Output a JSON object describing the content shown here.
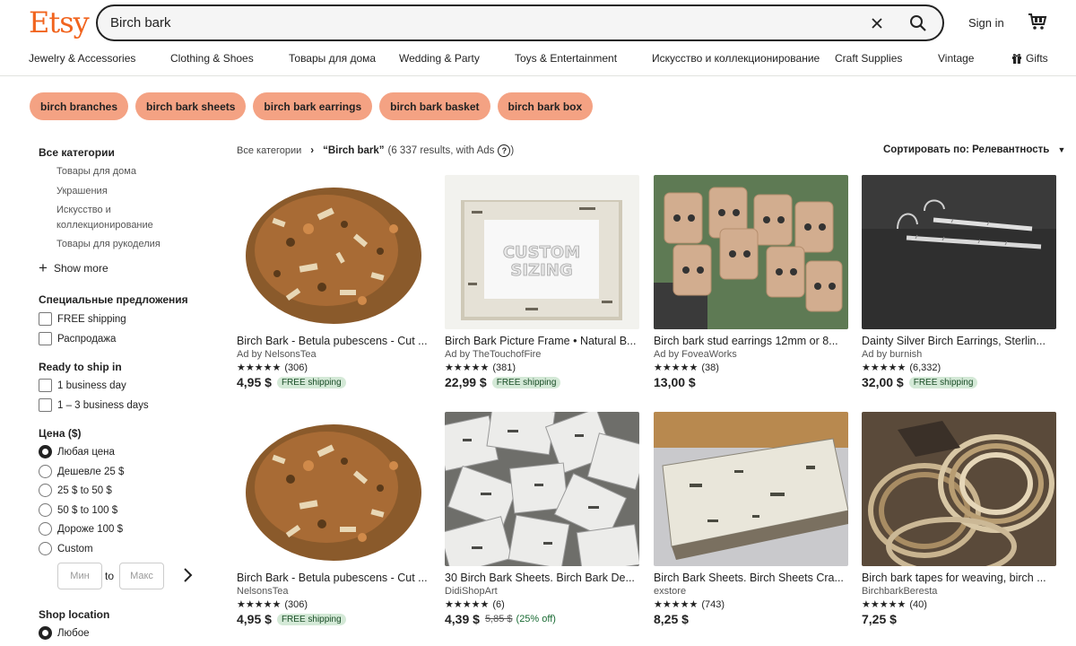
{
  "header": {
    "logo": "Etsy",
    "search_value": "Birch bark",
    "signin": "Sign in"
  },
  "categories": [
    "Jewelry & Accessories",
    "Clothing & Shoes",
    "Товары для дома",
    "Wedding & Party",
    "Toys & Entertainment",
    "Искусство и коллекционирование",
    "Craft Supplies",
    "Vintage",
    "Gifts"
  ],
  "chips": [
    "birch branches",
    "birch bark sheets",
    "birch bark earrings",
    "birch bark basket",
    "birch bark box"
  ],
  "sidebar": {
    "all_categories": "Все категории",
    "subcats": [
      "Товары для дома",
      "Украшения",
      "Искусство и",
      "коллекционирование",
      "Товары для рукоделия"
    ],
    "show_more": "Show more",
    "special_title": "Специальные предложения",
    "special": [
      "FREE shipping",
      "Распродажа"
    ],
    "ready_title": "Ready to ship in",
    "ready": [
      "1 business day",
      "1 – 3 business days"
    ],
    "price_title": "Цена ($)",
    "price_options": [
      "Любая цена",
      "Дешевле 25 $",
      "25 $ to 50 $",
      "50 $ to 100 $",
      "Дороже 100 $",
      "Custom"
    ],
    "min_placeholder": "Мин",
    "to": "to",
    "max_placeholder": "Макс",
    "location_title": "Shop location",
    "location_any": "Любое"
  },
  "breadcrumb": {
    "root": "Все категории",
    "query": "“Birch bark”",
    "results": "(6 337 results, with Ads"
  },
  "sort": {
    "label": "Сортировать по: Релевантность"
  },
  "listings": [
    {
      "title": "Birch Bark - Betula pubescens - Cut ...",
      "shop": "Ad by NelsonsTea",
      "reviews": "(306)",
      "price": "4,95 $",
      "free": "FREE shipping",
      "old": "",
      "disc": ""
    },
    {
      "title": "Birch Bark Picture Frame • Natural B...",
      "shop": "Ad by TheTouchofFire",
      "reviews": "(381)",
      "price": "22,99 $",
      "free": "FREE shipping",
      "old": "",
      "disc": ""
    },
    {
      "title": "Birch bark stud earrings 12mm or 8...",
      "shop": "Ad by FoveaWorks",
      "reviews": "(38)",
      "price": "13,00 $",
      "free": "",
      "old": "",
      "disc": ""
    },
    {
      "title": "Dainty Silver Birch Earrings, Sterlin...",
      "shop": "Ad by burnish",
      "reviews": "(6,332)",
      "price": "32,00 $",
      "free": "FREE shipping",
      "old": "",
      "disc": ""
    },
    {
      "title": "Birch Bark - Betula pubescens - Cut ...",
      "shop": "NelsonsTea",
      "reviews": "(306)",
      "price": "4,95 $",
      "free": "FREE shipping",
      "old": "",
      "disc": ""
    },
    {
      "title": "30 Birch Bark Sheets. Birch Bark De...",
      "shop": "DidiShopArt",
      "reviews": "(6)",
      "price": "4,39 $",
      "free": "",
      "old": "5,85 $",
      "disc": "(25% off)"
    },
    {
      "title": "Birch Bark Sheets. Birch Sheets Cra...",
      "shop": "exstore",
      "reviews": "(743)",
      "price": "8,25 $",
      "free": "",
      "old": "",
      "disc": ""
    },
    {
      "title": "Birch bark tapes for weaving, birch ...",
      "shop": "BirchbarkBeresta",
      "reviews": "(40)",
      "price": "7,25 $",
      "free": "",
      "old": "",
      "disc": ""
    }
  ],
  "stars": "★★★★★",
  "frame_text": "CUSTOM SIZING",
  "colors": {
    "brand": "#F1641E",
    "chip": "#F4A283",
    "free_ship_bg": "#d4e9d7"
  }
}
